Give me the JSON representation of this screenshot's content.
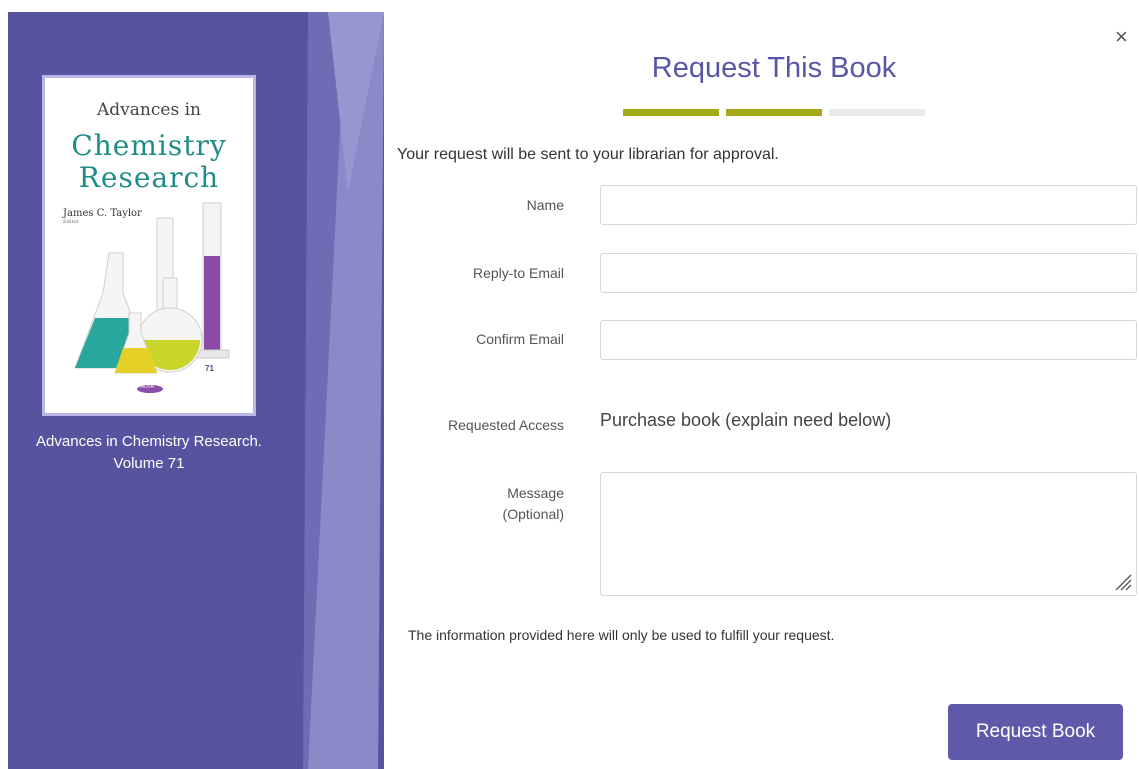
{
  "dialog": {
    "title": "Request This Book",
    "close_label": "×",
    "progress_steps": [
      {
        "state": "complete",
        "color": "#a3a917"
      },
      {
        "state": "complete",
        "color": "#a3a917"
      },
      {
        "state": "incomplete",
        "color": "#ebebeb"
      }
    ],
    "intro": "Your request will be sent to your librarian for approval.",
    "note": "The information provided here will only be used to fulfill your request.",
    "submit_label": "Request Book"
  },
  "book": {
    "cover": {
      "top_line": "Advances in",
      "title_line1": "Chemistry",
      "title_line2": "Research",
      "editor": "James C. Taylor",
      "editor_role": "Editor",
      "volume_number": "71",
      "publisher": "NOVA"
    },
    "caption_line1": "Advances in Chemistry Research.",
    "caption_line2": "Volume 71"
  },
  "form": {
    "name_label": "Name",
    "email_label": "Reply-to Email",
    "confirm_label": "Confirm Email",
    "access_label": "Requested Access",
    "access_value": "Purchase book (explain need below)",
    "message_label_line1": "Message",
    "message_label_line2": "(Optional)",
    "name_value": "",
    "email_value": "",
    "confirm_value": "",
    "message_value": ""
  },
  "colors": {
    "panel_bg": "#56539f",
    "accent": "#5e5aa9",
    "progress_done": "#a3a917",
    "progress_todo": "#ebebeb"
  }
}
